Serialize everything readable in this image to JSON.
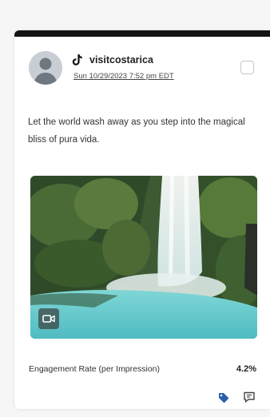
{
  "post": {
    "account_name": "visitcostarica",
    "platform_icon": "tiktok-icon",
    "date": "Sun 10/29/2023 7:52 pm EDT",
    "caption": "Let the world wash away as you step into the magical bliss of pura vida.",
    "media_type_icon": "video-icon"
  },
  "metric": {
    "label": "Engagement Rate (per Impression)",
    "value": "4.2%"
  },
  "footer_icons": [
    "tag-icon",
    "comment-icon"
  ],
  "colors": {
    "topbar": "#141414",
    "tag_icon": "#2a5fae",
    "water": "#5ec7c9"
  }
}
